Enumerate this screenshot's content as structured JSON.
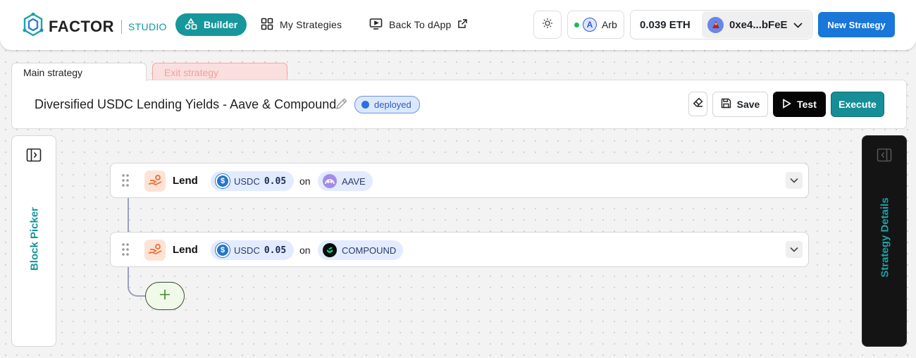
{
  "header": {
    "logo_text": "FACTOR",
    "logo_sub": "STUDIO",
    "nav": {
      "builder": "Builder",
      "my_strategies": "My Strategies",
      "back_to_dapp": "Back To dApp"
    },
    "network": "Arb",
    "network_icon_letter": "A",
    "balance": "0.039 ETH",
    "address": "0xe4...bFeE",
    "new_strategy": "New Strategy"
  },
  "tabs": {
    "main": "Main strategy",
    "exit": "Exit strategy"
  },
  "strategy": {
    "title": "Diversified USDC Lending Yields - Aave & Compound",
    "status": "deployed",
    "save_label": "Save",
    "test_label": "Test",
    "execute_label": "Execute"
  },
  "sidebars": {
    "left_label": "Block Picker",
    "right_label": "Strategy Details"
  },
  "blocks": [
    {
      "action": "Lend",
      "token": "USDC",
      "amount": "0.05",
      "on": "on",
      "protocol": "AAVE"
    },
    {
      "action": "Lend",
      "token": "USDC",
      "amount": "0.05",
      "on": "on",
      "protocol": "COMPOUND"
    }
  ],
  "colors": {
    "brand": "#16979c",
    "new_strategy": "#1877d8",
    "exit_tab": "#fbdede",
    "status": "#2e6fe0"
  },
  "icons": [
    "factor-logo-icon",
    "builder-icon",
    "grid-icon",
    "monitor-icon",
    "external-link-icon",
    "sun-icon",
    "arbitrum-icon",
    "chevron-down-icon",
    "eraser-icon",
    "save-icon",
    "play-icon",
    "panel-toggle-icon",
    "drag-handle-icon",
    "lend-icon",
    "usdc-icon",
    "aave-icon",
    "compound-icon",
    "plus-icon"
  ]
}
